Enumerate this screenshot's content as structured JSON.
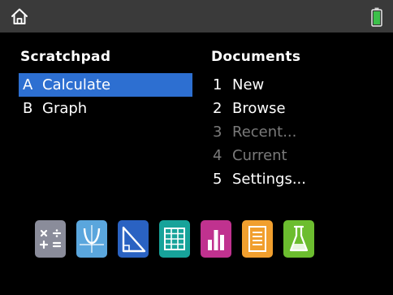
{
  "colors": {
    "background": "#000000",
    "status_bar": "#3a3a3a",
    "selection": "#2d6fd1",
    "disabled_text": "#7a7a7a",
    "battery": "#3cc04a"
  },
  "status_bar": {
    "left_icon": "home-icon",
    "right_icon": "battery-icon"
  },
  "scratchpad": {
    "heading": "Scratchpad",
    "items": [
      {
        "key": "A",
        "label": "Calculate"
      },
      {
        "key": "B",
        "label": "Graph"
      }
    ]
  },
  "documents": {
    "heading": "Documents",
    "items": [
      {
        "key": "1",
        "label": "New"
      },
      {
        "key": "2",
        "label": "Browse"
      },
      {
        "key": "3",
        "label": "Recent..."
      },
      {
        "key": "4",
        "label": "Current"
      },
      {
        "key": "5",
        "label": "Settings..."
      }
    ]
  },
  "apps": [
    {
      "icon": "calculator-icon",
      "color": "#8a8c9a"
    },
    {
      "icon": "graphs-icon",
      "color": "#5aa6dd"
    },
    {
      "icon": "geometry-icon",
      "color": "#2a62c2"
    },
    {
      "icon": "spreadsheet-icon",
      "color": "#17a39a"
    },
    {
      "icon": "data-stats-icon",
      "color": "#c0328f"
    },
    {
      "icon": "notes-icon",
      "color": "#f19f2e"
    },
    {
      "icon": "vernier-lab-icon",
      "color": "#6cbd2f"
    }
  ]
}
